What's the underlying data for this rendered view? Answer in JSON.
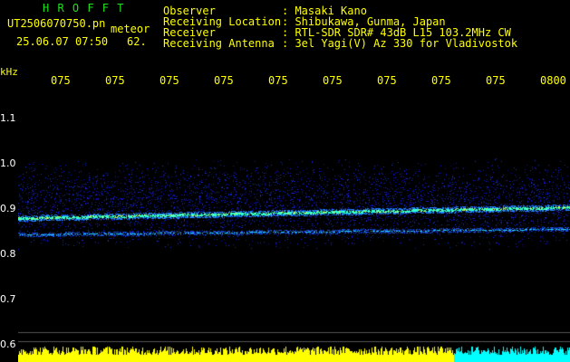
{
  "brand": "H R O F F T",
  "file_name": "UT2506070750.pn",
  "sub_label": "meteor",
  "datetime": "25.06.07 07:50",
  "count": "62.",
  "info": {
    "rows": [
      {
        "label": "Observer",
        "value": ": Masaki Kano"
      },
      {
        "label": "Receiving Location",
        "value": ": Shibukawa, Gunma, Japan"
      },
      {
        "label": "Receiver",
        "value": ": RTL-SDR SDR# 43dB L15 103.2MHz CW"
      },
      {
        "label": "Receiving Antenna",
        "value": ": 3el Yagi(V) Az 330 for Vladivostok"
      }
    ]
  },
  "x_unit": "kHz",
  "x_ticks": [
    "075",
    "075",
    "075",
    "075",
    "075",
    "075",
    "075",
    "075",
    "075",
    "0800"
  ],
  "y_ticks": [
    "1.1",
    "1.0",
    "0.9",
    "0.8",
    "0.7",
    "0.6"
  ],
  "colors": {
    "title_green": "#1ee31e",
    "text_yellow": "#ffff00",
    "signal_cyan": "#00ffff",
    "noise_blue": "#0a1ea0"
  }
}
